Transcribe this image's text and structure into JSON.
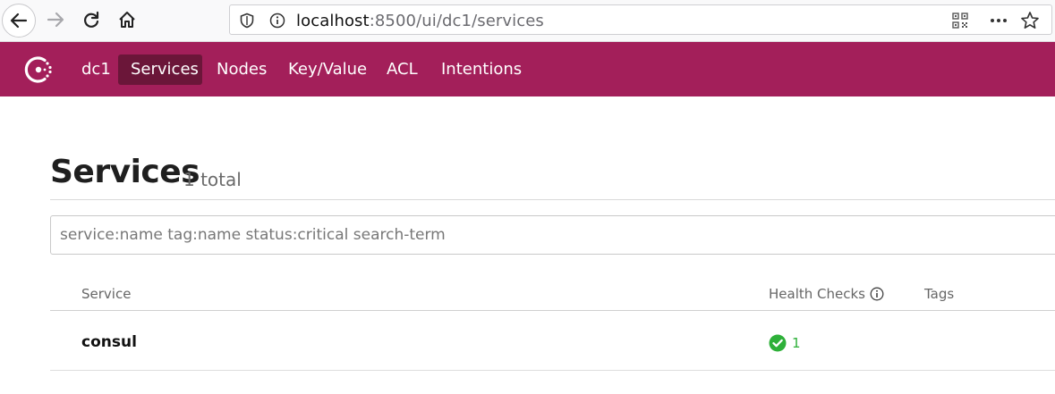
{
  "browser": {
    "url_host": "localhost",
    "url_path": ":8500/ui/dc1/services"
  },
  "header": {
    "datacenter": "dc1",
    "nav": [
      {
        "label": "Services",
        "active": true
      },
      {
        "label": "Nodes",
        "active": false
      },
      {
        "label": "Key/Value",
        "active": false
      },
      {
        "label": "ACL",
        "active": false
      },
      {
        "label": "Intentions",
        "active": false
      }
    ],
    "brand_color": "#a31f5a",
    "active_color": "#6b1639"
  },
  "main": {
    "title": "Services",
    "total": "1 total",
    "search": {
      "placeholder": "service:name tag:name status:critical search-term",
      "value": ""
    },
    "columns": [
      "Service",
      "Health Checks",
      "Tags"
    ],
    "rows": [
      {
        "service": "consul",
        "health_passing": "1",
        "tags": ""
      }
    ],
    "health_color": "#2eb039"
  }
}
